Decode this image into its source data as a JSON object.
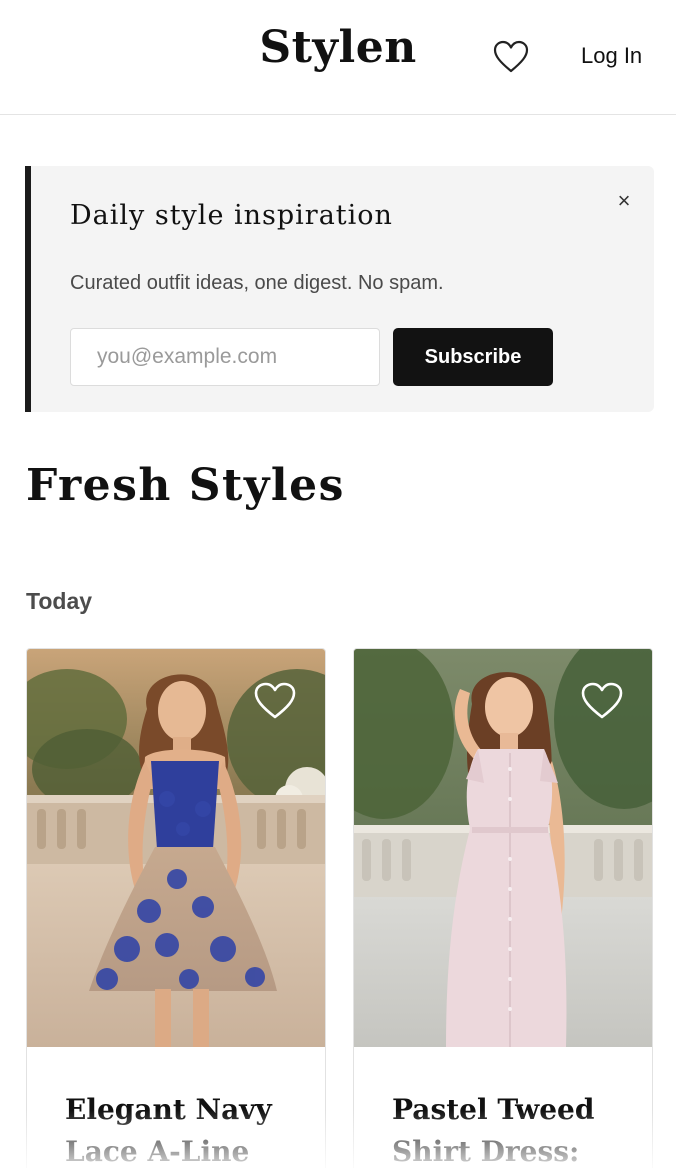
{
  "header": {
    "brand": "Stylen",
    "favorites_icon": "heart-outline-icon",
    "login_label": "Log In"
  },
  "newsletter": {
    "title": "Daily style inspiration",
    "close_icon": "close-icon",
    "close_symbol": "×",
    "description": "Curated outfit ideas, one digest. No spam.",
    "email_placeholder": "you@example.com",
    "email_value": "",
    "subscribe_label": "Subscribe"
  },
  "feed": {
    "title": "Fresh Styles",
    "group_label": "Today",
    "cards": [
      {
        "title": "Elegant Navy Lace A-Line",
        "image": "woman-in-navy-lace-dress-photo",
        "favorite_icon": "heart-outline-icon"
      },
      {
        "title": "Pastel Tweed Shirt Dress: The",
        "image": "woman-in-pastel-tweed-dress-photo",
        "favorite_icon": "heart-outline-icon"
      }
    ]
  },
  "colors": {
    "accent": "#121212",
    "banner_bg": "#f4f4f4",
    "muted_text": "#4c4c4c"
  }
}
